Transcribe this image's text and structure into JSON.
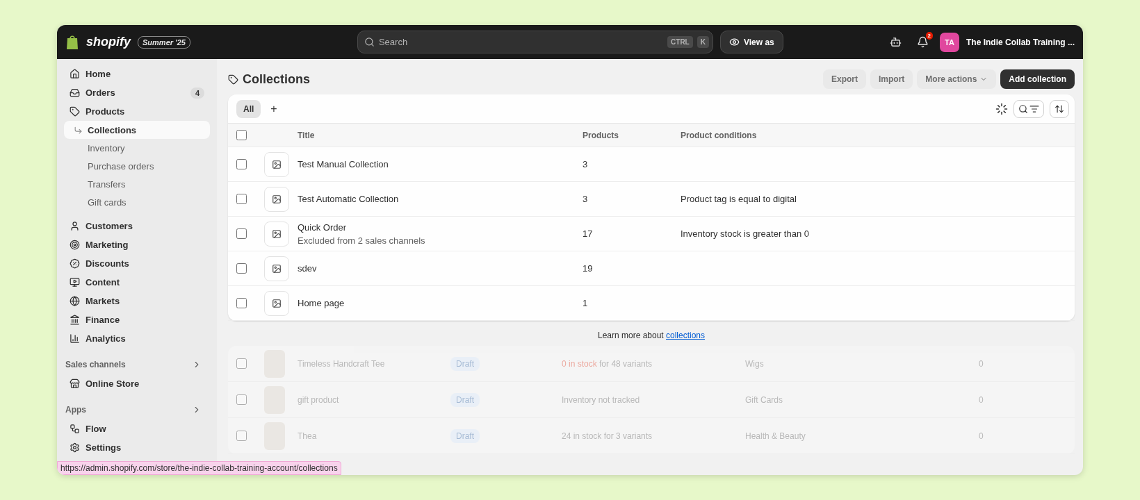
{
  "topbar": {
    "brand": "shopify",
    "edition": "Summer '25",
    "search": {
      "placeholder": "Search",
      "keys": [
        "CTRL",
        "K"
      ]
    },
    "view_as": "View as",
    "notifications": "2",
    "avatar": "TA",
    "store": "The Indie Collab Training ..."
  },
  "sidebar": {
    "items": [
      {
        "label": "Home",
        "selected": false
      },
      {
        "label": "Orders",
        "badge": "4",
        "selected": false
      },
      {
        "label": "Products",
        "selected": false,
        "children": [
          {
            "label": "Collections",
            "selected": true
          },
          {
            "label": "Inventory",
            "selected": false
          },
          {
            "label": "Purchase orders",
            "selected": false
          },
          {
            "label": "Transfers",
            "selected": false
          },
          {
            "label": "Gift cards",
            "selected": false
          }
        ]
      },
      {
        "label": "Customers",
        "selected": false
      },
      {
        "label": "Marketing",
        "selected": false
      },
      {
        "label": "Discounts",
        "selected": false
      },
      {
        "label": "Content",
        "selected": false
      },
      {
        "label": "Markets",
        "selected": false
      },
      {
        "label": "Finance",
        "selected": false
      },
      {
        "label": "Analytics",
        "selected": false
      }
    ],
    "sections": [
      {
        "title": "Sales channels",
        "items": [
          {
            "label": "Online Store",
            "selected": false
          }
        ]
      },
      {
        "title": "Apps",
        "items": [
          {
            "label": "Flow",
            "selected": false
          },
          {
            "label": "Settings",
            "selected": false
          }
        ]
      }
    ]
  },
  "page": {
    "title": "Collections",
    "actions": [
      {
        "label": "Export",
        "kind": "plain",
        "disabled": true
      },
      {
        "label": "Import",
        "kind": "plain",
        "disabled": true
      },
      {
        "label": "More actions",
        "kind": "menu",
        "disabled": true
      },
      {
        "label": "Add collection",
        "kind": "primary",
        "disabled": false
      }
    ]
  },
  "tabs": [
    {
      "label": "All",
      "selected": true
    }
  ],
  "add_tab": "+",
  "table": {
    "select_all_checked": false,
    "columns": [
      "Title",
      "Products",
      "Product conditions"
    ],
    "rows": [
      {
        "title": "Test Manual Collection",
        "products": "3",
        "checked": false
      },
      {
        "title": "Test Automatic Collection",
        "products": "3",
        "conditions": "Product tag is equal to digital",
        "checked": false
      },
      {
        "title": "Quick Order",
        "note": "Excluded from 2 sales channels",
        "products": "17",
        "conditions": "Inventory stock is greater than 0",
        "checked": false
      },
      {
        "title": "sdev",
        "products": "19",
        "checked": false
      },
      {
        "title": "Home page",
        "products": "1",
        "checked": false
      }
    ]
  },
  "footer": {
    "text": "Learn more about ",
    "link": "collections"
  },
  "background_rows": [
    {
      "name": "Timeless Handcraft Tee",
      "status": "Draft",
      "stock": "0 in stock",
      "detail": "for 48 variants",
      "out_of_stock": true,
      "category": "Wigs",
      "channels": "0",
      "checked": false
    },
    {
      "name": "gift product",
      "status": "Draft",
      "stock": "Inventory not tracked",
      "out_of_stock": false,
      "category": "Gift Cards",
      "channels": "0",
      "checked": false
    },
    {
      "name": "Thea",
      "status": "Draft",
      "stock": "24 in stock for 3 variants",
      "out_of_stock": false,
      "category": "Health & Beauty",
      "channels": "0",
      "checked": false
    }
  ],
  "status_url": "https://admin.shopify.com/store/the-indie-collab-training-account/collections"
}
